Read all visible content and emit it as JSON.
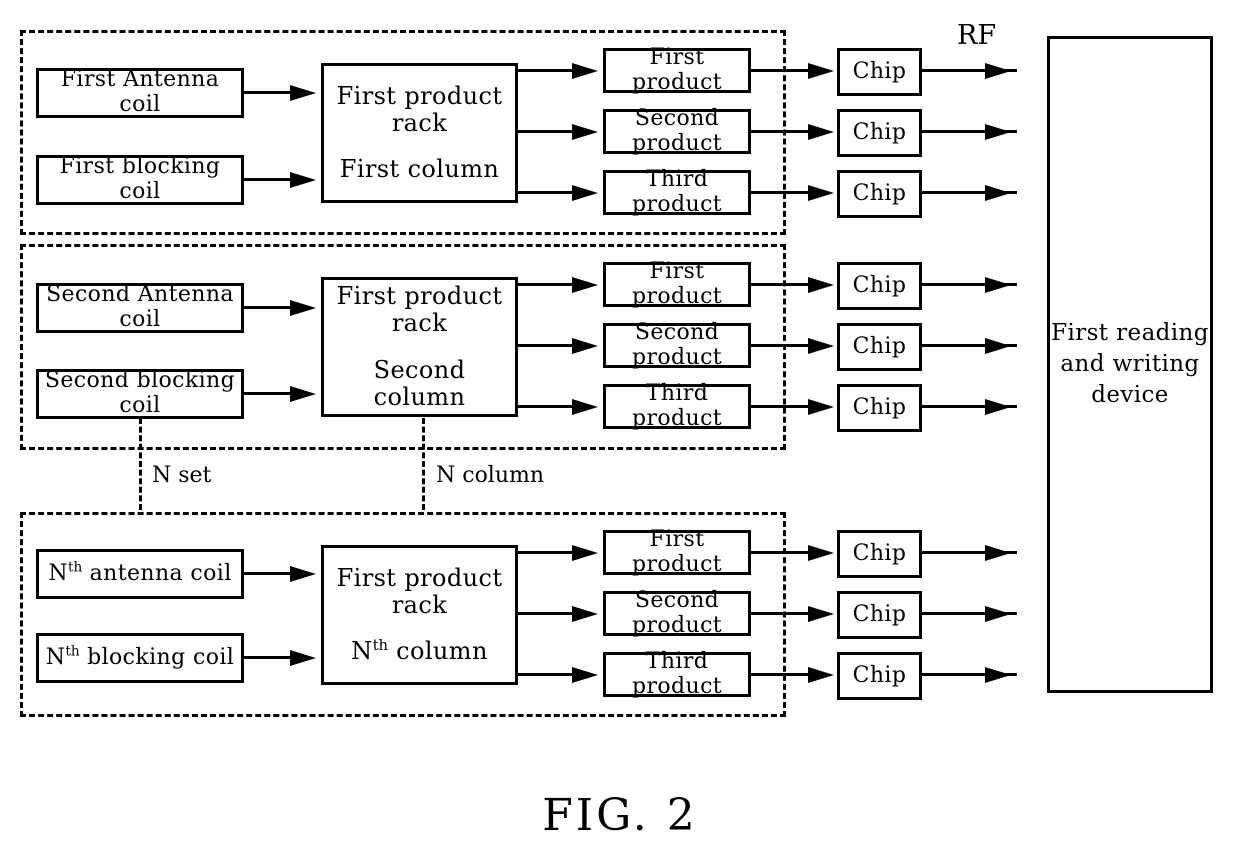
{
  "figure": {
    "caption": "FIG. 2",
    "rf_label": "RF",
    "markers": {
      "n_set": "N set",
      "n_column": "N column"
    }
  },
  "groups": [
    {
      "id": "first-column-group",
      "antenna_coil": "First Antenna coil",
      "blocking_coil": "First blocking coil",
      "rack_line1": "First product rack",
      "rack_line2": "First column",
      "products": [
        "First product",
        "Second product",
        "Third product"
      ],
      "chips": [
        "Chip",
        "Chip",
        "Chip"
      ]
    },
    {
      "id": "second-column-group",
      "antenna_coil": "Second Antenna coil",
      "blocking_coil": "Second blocking coil",
      "rack_line1": "First product rack",
      "rack_line2": "Second column",
      "products": [
        "First product",
        "Second product",
        "Third product"
      ],
      "chips": [
        "Chip",
        "Chip",
        "Chip"
      ]
    },
    {
      "id": "nth-column-group",
      "antenna_coil_prefix": "N",
      "antenna_coil_sup": "th",
      "antenna_coil_rest": " antenna coil",
      "blocking_coil_prefix": "N",
      "blocking_coil_sup": "th",
      "blocking_coil_rest": " blocking coil",
      "rack_line1": "First product rack",
      "rack_line2_prefix": "N",
      "rack_line2_sup": "th",
      "rack_line2_rest": " column",
      "products": [
        "First product",
        "Second product",
        "Third product"
      ],
      "chips": [
        "Chip",
        "Chip",
        "Chip"
      ]
    }
  ],
  "reader": {
    "line1": "First reading",
    "line2": "and writing",
    "line3": "device"
  },
  "colors": {
    "stroke": "#000000",
    "background": "#ffffff"
  }
}
